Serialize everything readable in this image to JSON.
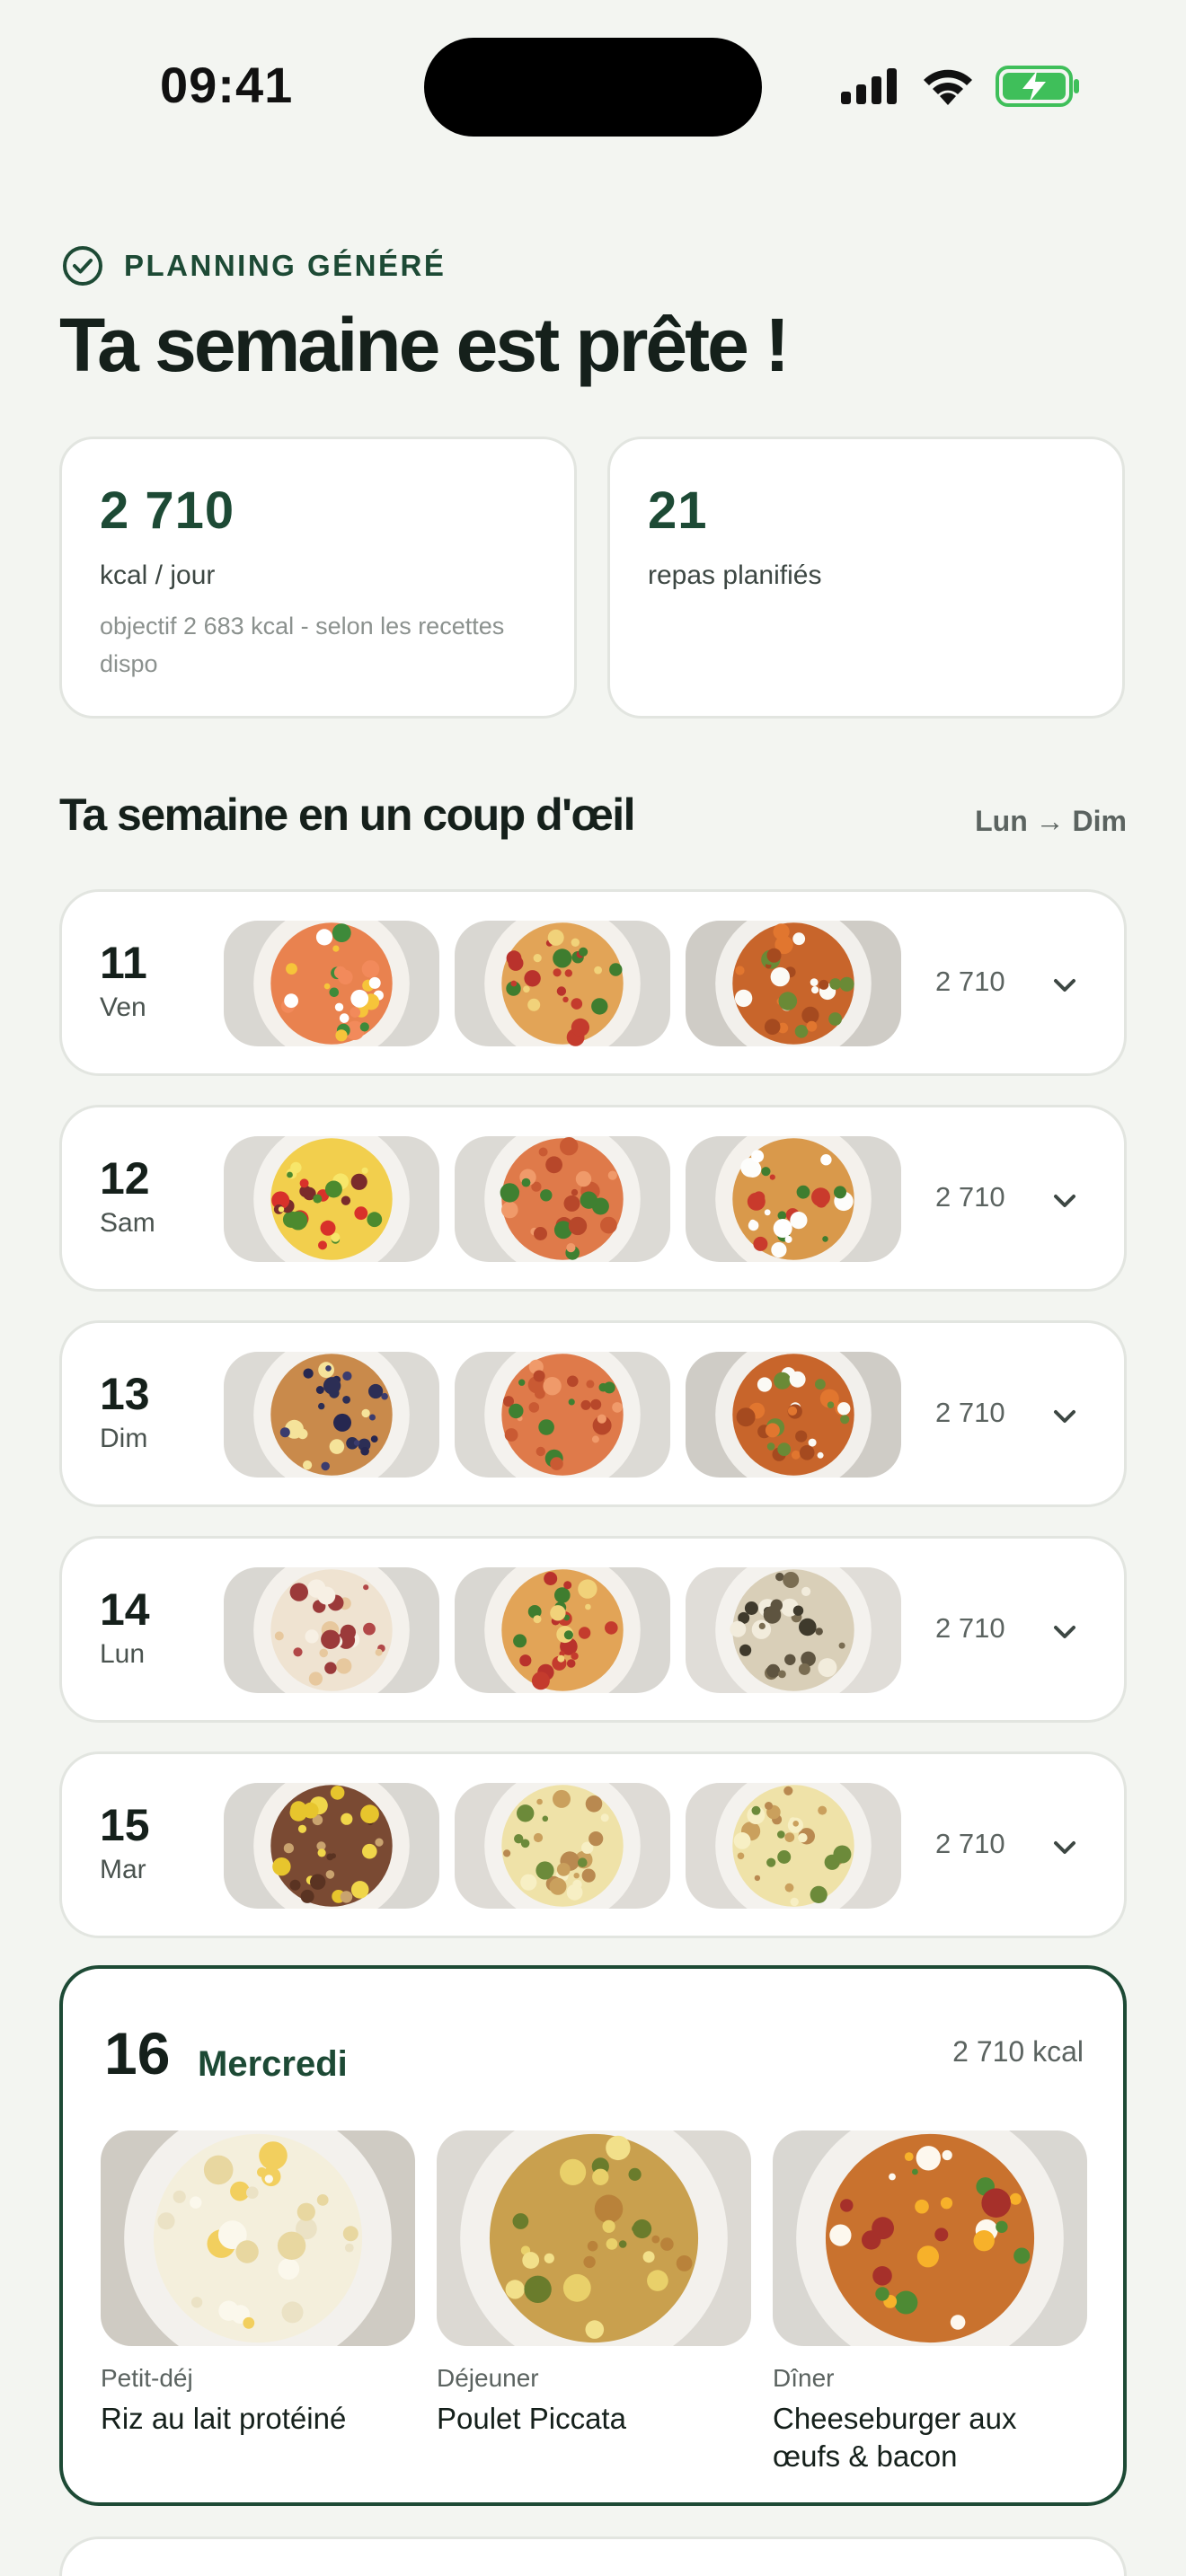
{
  "status_bar": {
    "time": "09:41"
  },
  "header": {
    "eyebrow": "PLANNING GÉNÉRÉ",
    "title": "Ta semaine est prête !"
  },
  "stats": {
    "kcal": {
      "value": "2 710",
      "label": "kcal / jour",
      "note": "objectif 2 683 kcal - selon les recettes dispo"
    },
    "meals": {
      "value": "21",
      "label": "repas planifiés"
    }
  },
  "week": {
    "title": "Ta semaine en un coup d'œil",
    "range": "Lun → Dim",
    "days": [
      {
        "num": "11",
        "name": "Ven",
        "kcal": "2 710",
        "meals": [
          "salmon-toast",
          "pizza",
          "chicken-rice"
        ]
      },
      {
        "num": "12",
        "name": "Sam",
        "kcal": "2 710",
        "meals": [
          "egg-toast-salad",
          "penne",
          "pizza-mozzarella"
        ]
      },
      {
        "num": "13",
        "name": "Dim",
        "kcal": "2 710",
        "meals": [
          "pancakes-blueberry",
          "penne",
          "chicken-rice"
        ]
      },
      {
        "num": "14",
        "name": "Lun",
        "kcal": "2 710",
        "meals": [
          "oatmeal-figs",
          "pizza",
          "risotto-mushroom"
        ]
      },
      {
        "num": "15",
        "name": "Mar",
        "kcal": "2 710",
        "meals": [
          "oatmeal-kiwi",
          "risotto-chicken",
          "risotto-chicken"
        ]
      }
    ]
  },
  "expanded_day": {
    "num": "16",
    "name": "Mercredi",
    "kcal": "2 710 kcal",
    "meals": [
      {
        "type": "Petit-déj",
        "title": "Riz au lait protéiné",
        "image": "rice-pudding"
      },
      {
        "type": "Déjeuner",
        "title": "Poulet Piccata",
        "image": "chicken-piccata"
      },
      {
        "type": "Dîner",
        "title": "Cheeseburger aux œufs & bacon",
        "image": "cheeseburger"
      }
    ]
  },
  "colors": {
    "accent": "#1d4a35",
    "background": "#f3f5f1",
    "battery": "#3fbf5a"
  }
}
